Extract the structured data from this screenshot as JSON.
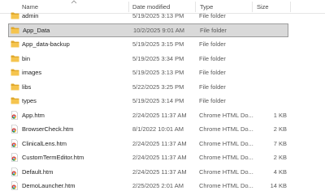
{
  "columns": {
    "name": "Name",
    "date": "Date modified",
    "type": "Type",
    "size": "Size"
  },
  "files": [
    {
      "name": "admin",
      "date": "5/19/2025 3:13 PM",
      "type": "File folder",
      "size": "",
      "icon": "folder-icon"
    },
    {
      "name": "App_Data",
      "date": "10/2/2025 9:01 AM",
      "type": "File folder",
      "size": "",
      "icon": "folder-icon",
      "selected": true
    },
    {
      "name": "App_data-backup",
      "date": "5/19/2025 3:15 PM",
      "type": "File folder",
      "size": "",
      "icon": "folder-icon"
    },
    {
      "name": "bin",
      "date": "5/19/2025 3:34 PM",
      "type": "File folder",
      "size": "",
      "icon": "folder-icon"
    },
    {
      "name": "images",
      "date": "5/19/2025 3:13 PM",
      "type": "File folder",
      "size": "",
      "icon": "folder-icon"
    },
    {
      "name": "libs",
      "date": "5/22/2025 3:25 PM",
      "type": "File folder",
      "size": "",
      "icon": "folder-icon"
    },
    {
      "name": "types",
      "date": "5/19/2025 3:14 PM",
      "type": "File folder",
      "size": "",
      "icon": "folder-icon"
    },
    {
      "name": "App.htm",
      "date": "2/24/2025 11:37 AM",
      "type": "Chrome HTML Do...",
      "size": "1 KB",
      "icon": "chrome-html-icon"
    },
    {
      "name": "BrowserCheck.htm",
      "date": "8/1/2022 10:01 AM",
      "type": "Chrome HTML Do...",
      "size": "2 KB",
      "icon": "chrome-html-icon"
    },
    {
      "name": "ClinicalLens.htm",
      "date": "2/24/2025 11:37 AM",
      "type": "Chrome HTML Do...",
      "size": "7 KB",
      "icon": "chrome-html-icon"
    },
    {
      "name": "CustomTermEditor.htm",
      "date": "2/24/2025 11:37 AM",
      "type": "Chrome HTML Do...",
      "size": "2 KB",
      "icon": "chrome-html-icon"
    },
    {
      "name": "Default.htm",
      "date": "2/24/2025 11:37 AM",
      "type": "Chrome HTML Do...",
      "size": "4 KB",
      "icon": "chrome-html-icon"
    },
    {
      "name": "DemoLauncher.htm",
      "date": "2/25/2025 2:01 AM",
      "type": "Chrome HTML Do...",
      "size": "14 KB",
      "icon": "chrome-html-icon"
    }
  ],
  "colors": {
    "folder": "#f5c44e",
    "folder_dark": "#e0a82a",
    "selection": "#d9d9d9"
  }
}
